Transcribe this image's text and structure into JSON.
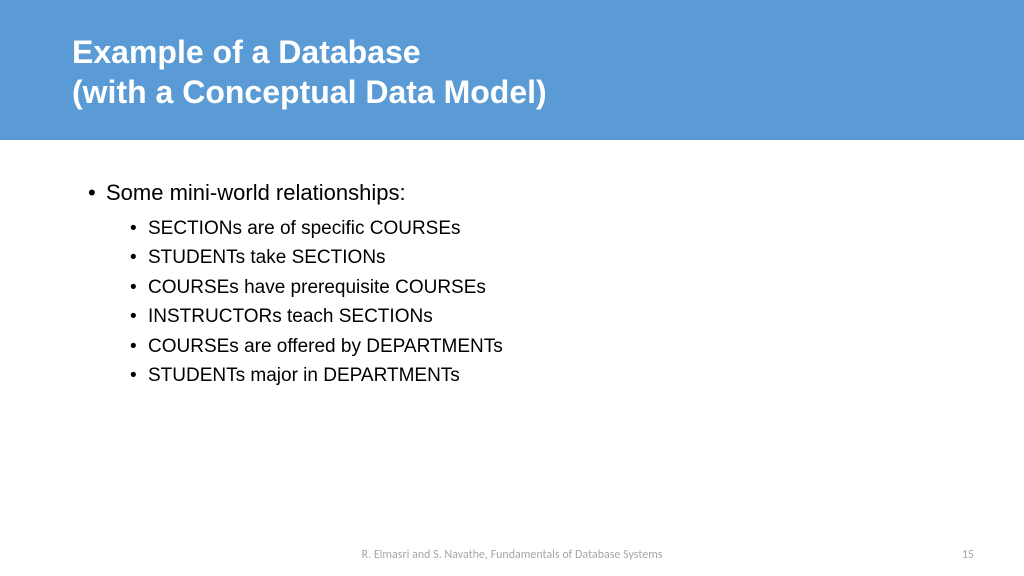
{
  "header": {
    "title_line1": "Example of a Database",
    "title_line2": "(with a Conceptual Data Model)"
  },
  "content": {
    "main_bullet": "Some mini-world relationships:",
    "sub_bullets": [
      "SECTIONs are of specific COURSEs",
      "STUDENTs take SECTIONs",
      "COURSEs have  prerequisite COURSEs",
      "INSTRUCTORs teach  SECTIONs",
      "COURSEs are offered by  DEPARTMENTs",
      "STUDENTs major in  DEPARTMENTs"
    ]
  },
  "footer": {
    "citation": "R. Elmasri and S. Navathe, Fundamentals of Database Systems",
    "page_number": "15"
  }
}
